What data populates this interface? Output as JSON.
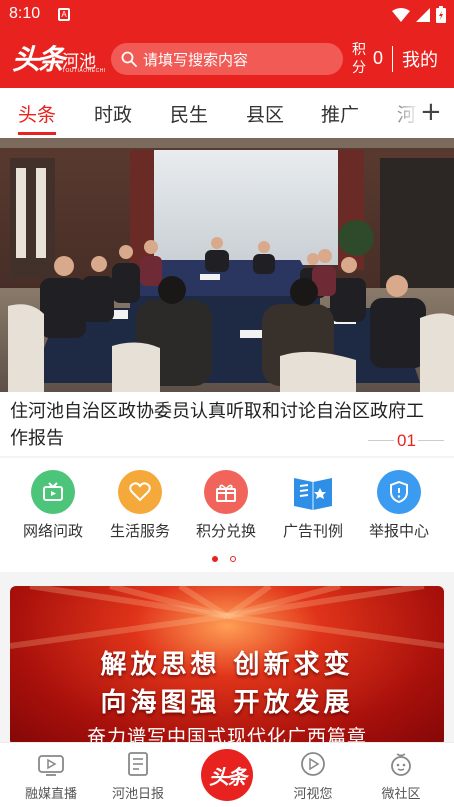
{
  "status_bar": {
    "time": "8:10",
    "notif_letter": "A"
  },
  "header": {
    "logo_script": "头条",
    "logo_city": "河池",
    "logo_sub": "TOUTIAOHECHI",
    "search_placeholder": "请填写搜索内容",
    "points_label": "积分",
    "points_value": "0",
    "mine": "我的"
  },
  "tabs": [
    {
      "label": "头条",
      "active": true
    },
    {
      "label": "时政"
    },
    {
      "label": "民生"
    },
    {
      "label": "县区"
    },
    {
      "label": "推广"
    },
    {
      "label": "河"
    }
  ],
  "hero": {
    "caption": "住河池自治区政协委员认真听取和讨论自治区政府工作报告",
    "page_number": "01"
  },
  "services": [
    {
      "label": "网络问政",
      "icon": "tv-icon",
      "color": "#4cc47a"
    },
    {
      "label": "生活服务",
      "icon": "heart-icon",
      "color": "#f5a93a"
    },
    {
      "label": "积分兑换",
      "icon": "gift-icon",
      "color": "#f0645c"
    },
    {
      "label": "广告刊例",
      "icon": "book-icon",
      "color": "#2f8fe6"
    },
    {
      "label": "举报中心",
      "icon": "shield-icon",
      "color": "#3a9bf0"
    }
  ],
  "pager": {
    "active_color": "#e8231f"
  },
  "banner": {
    "line1": "解放思想 创新求变",
    "line2": "向海图强 开放发展",
    "line3": "奋力谱写中国式现代化广西篇章"
  },
  "bottom_nav": [
    {
      "label": "融媒直播",
      "icon": "tv-icon"
    },
    {
      "label": "河池日报",
      "icon": "newspaper-icon"
    },
    {
      "label": "头条",
      "icon": "logo-icon"
    },
    {
      "label": "河视您",
      "icon": "play-icon"
    },
    {
      "label": "微社区",
      "icon": "community-icon"
    }
  ],
  "colors": {
    "brand": "#e8231f"
  }
}
